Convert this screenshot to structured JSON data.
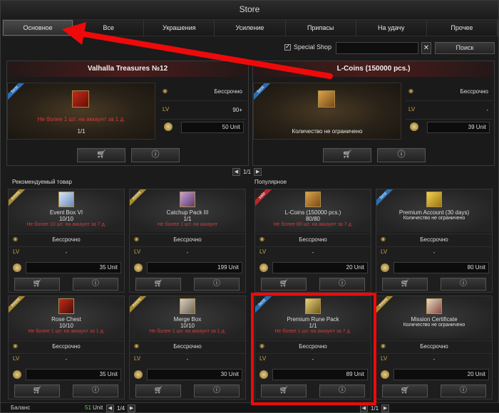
{
  "window": {
    "title": "Store"
  },
  "tabs": [
    "Основное",
    "Все",
    "Украшения",
    "Усиление",
    "Припасы",
    "На удачу",
    "Прочее"
  ],
  "toolbar": {
    "special_shop": "Special Shop",
    "search_label": "Поиск",
    "clear": "✕"
  },
  "featured": [
    {
      "title": "Valhalla Treasures №12",
      "badge": "best",
      "limit": "Не более 1 шт. на аккаунт за 1 д.",
      "qty": "1/1",
      "duration": "Бессрочно",
      "level": "90+",
      "price": "50 Unit"
    },
    {
      "title": "L-Coins (150000 pcs.)",
      "badge": "best",
      "limit": "Количество не ограничено",
      "qty": "",
      "duration": "Бессрочно",
      "level": "-",
      "price": "39 Unit"
    }
  ],
  "featured_pager": {
    "page": "1/1"
  },
  "sections": {
    "recommended": "Рекомендуемый товар",
    "popular": "Популярное"
  },
  "cards": [
    {
      "name": "Event Box VI",
      "badge": "event",
      "qty": "10/10",
      "limit": "Не более 10 шт. на аккаунт за 7 д.",
      "duration": "Бессрочно",
      "level": "-",
      "price": "35 Unit"
    },
    {
      "name": "Catchup Pack III",
      "badge": "event",
      "qty": "1/1",
      "limit": "Не более 1 шт. на аккаунт",
      "duration": "Бессрочно",
      "level": "-",
      "price": "199 Unit"
    },
    {
      "name": "L-Coins (150000 pcs.)",
      "badge": "sale",
      "qty": "80/80",
      "limit": "Не более 80 шт. на аккаунт за 7 д.",
      "duration": "Бессрочно",
      "level": "-",
      "price": "20 Unit"
    },
    {
      "name": "Premium Account (30 days)",
      "badge": "best",
      "qty": "",
      "limit": "Количество не ограничено",
      "duration": "Бессрочно",
      "level": "-",
      "price": "80 Unit"
    },
    {
      "name": "Rose Chest",
      "badge": "event",
      "qty": "10/10",
      "limit": "Не более 1 шт. на аккаунт за 1 д.",
      "duration": "Бессрочно",
      "level": "-",
      "price": "35 Unit"
    },
    {
      "name": "Merge Box",
      "badge": "event",
      "qty": "10/10",
      "limit": "Не более 1 шт. на аккаунт за 1 д.",
      "duration": "Бессрочно",
      "level": "-",
      "price": "30 Unit"
    },
    {
      "name": "Premium Rune Pack",
      "badge": "best",
      "qty": "1/1",
      "limit": "Не более 1 шт. на аккаунт за 7 д.",
      "duration": "Бессрочно",
      "level": "-",
      "price": "89 Unit"
    },
    {
      "name": "Mission Certificate",
      "badge": "event",
      "qty": "",
      "limit": "Количество не ограничено",
      "duration": "Бессрочно",
      "level": "-",
      "price": "20 Unit"
    }
  ],
  "bottom": {
    "balance_label": "Баланс",
    "balance_value": "51",
    "balance_unit": "Unit",
    "page_left": "1/4",
    "page_right": "1/1"
  },
  "icons": {
    "cart": "cart-icon",
    "info": "info-icon",
    "coin": "coin-icon",
    "clock": "clock-icon"
  },
  "colors": {
    "limit_red": "#d23a3a",
    "highlight_red": "#ee0a0a",
    "balance_green": "#4fd64f"
  }
}
